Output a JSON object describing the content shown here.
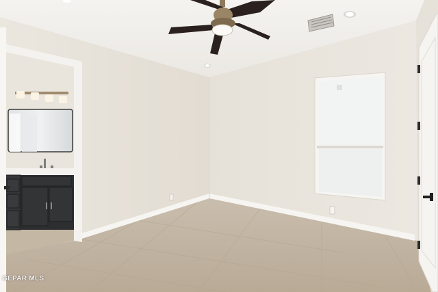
{
  "watermark": "GEPAR MLS",
  "colors": {
    "ceiling": "#f1efeb",
    "wall_left": "#e4ded4",
    "wall_back": "#e9e4dc",
    "floor": "#c8bba9",
    "trim": "#f7f6f3",
    "fan_blade": "#2a211e",
    "vanity_cabinet": "#2c2e30",
    "window_glass": "#f2f3f3"
  },
  "icons": [
    "ceiling-fan-icon",
    "recessed-light-icon",
    "air-vent-icon",
    "vanity-light-icon"
  ]
}
